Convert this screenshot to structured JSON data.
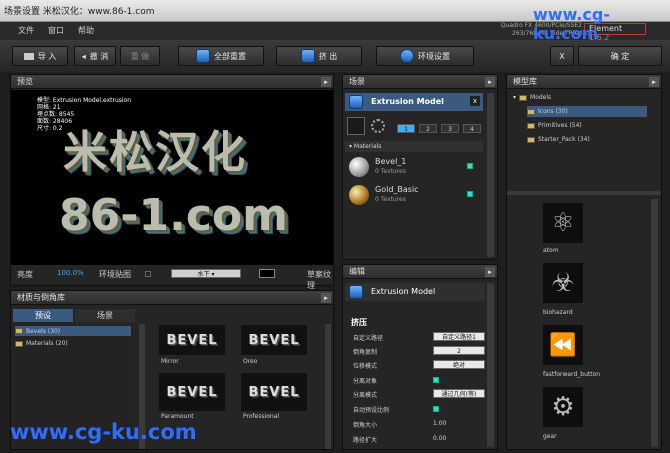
{
  "window": {
    "title": "场景设置  米松汉化：www.86-1.com"
  },
  "menu": [
    "文件",
    "窗口",
    "帮助"
  ],
  "sysinfo": [
    "Quadro FX 4600/PCIe/SSE2",
    "263/768 MB Video RAM"
  ],
  "element": {
    "name": "Element",
    "version": "1.6.2"
  },
  "watermark": "www.cg-ku.com",
  "toolbar": {
    "import": "导 入",
    "undo": "撤 消",
    "redo": "重 做",
    "reset_all": "全部重置",
    "extrude": "挤 出",
    "environment": "环境设置",
    "close": "X",
    "ok": "确 定"
  },
  "preview": {
    "title": "预览",
    "info": [
      "模型: Extrusion Model.extrusion",
      "网格: 21",
      "埋点数: 8545",
      "面数: 28406",
      "尺寸: 0.2"
    ],
    "big1": "米松汉化",
    "big2": "86-1.com",
    "brightness_label": "亮度",
    "brightness_value": "100.0%",
    "env_label": "环境贴图",
    "env_value": "水下",
    "draft_label": "草案纹理"
  },
  "materials": {
    "title": "材质与倒角库",
    "tabs": [
      "预设",
      "场景"
    ],
    "tree": [
      "Bevels (30)",
      "Materials (20)"
    ],
    "thumbs": [
      {
        "text": "BEVEL",
        "label": "Mirror"
      },
      {
        "text": "BEVEL",
        "label": "Oreo"
      },
      {
        "text": "BEVEL",
        "label": "Paramount"
      },
      {
        "text": "BEVEL",
        "label": "Professional"
      }
    ]
  },
  "scene": {
    "title": "场景",
    "model": "Extrusion Model",
    "close": "x",
    "nums": [
      "1",
      "2",
      "3",
      "4"
    ],
    "mat_header": "Materials",
    "items": [
      {
        "name": "Bevel_1",
        "sub": "0 Textures"
      },
      {
        "name": "Gold_Basic",
        "sub": "0 Textures"
      }
    ]
  },
  "edit": {
    "title": "编辑",
    "model": "Extrusion Model",
    "section": "挤压",
    "rows": [
      {
        "label": "自定义路径",
        "value": "自定义路径1"
      },
      {
        "label": "倒角复制",
        "value": "2"
      },
      {
        "label": "位移模式",
        "value": "绝对"
      },
      {
        "label": "分离对象",
        "value": ""
      },
      {
        "label": "分离模式",
        "value": "通过几何(等)"
      },
      {
        "label": "自动预设比例",
        "value": ""
      },
      {
        "label": "倒角大小",
        "value": "1.00"
      },
      {
        "label": "路径扩大",
        "value": "0.00"
      }
    ]
  },
  "models": {
    "title": "模型库",
    "tree": [
      "Models",
      "Icons (30)",
      "Primitives (54)",
      "Starter_Pack (34)"
    ],
    "items": [
      "atom",
      "biohazard",
      "fastforward_button",
      "gear"
    ]
  },
  "colors": {
    "accent": "#36b3ff",
    "check": "#3ad5e8",
    "watermark": "#2f6dff"
  }
}
